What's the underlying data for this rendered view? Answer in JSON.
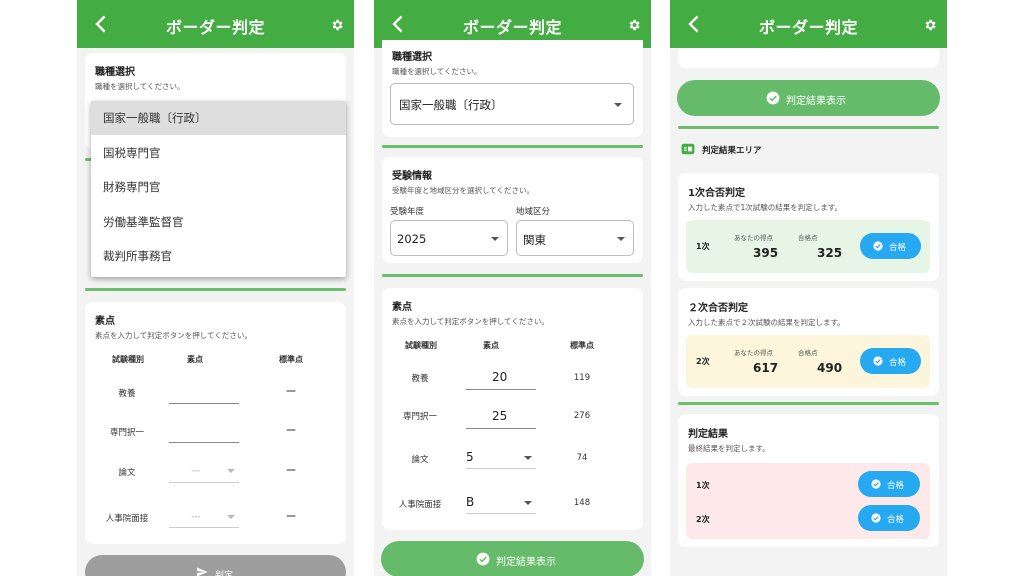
{
  "app": {
    "title": "ボーダー判定"
  },
  "job": {
    "title": "職種選択",
    "desc": "職種を選択してください。",
    "selected": "国家一般職〔行政〕",
    "options": [
      "国家一般職〔行政〕",
      "国税専門官",
      "財務専門官",
      "労働基準監督官",
      "裁判所事務官"
    ]
  },
  "exam": {
    "title": "受験情報",
    "desc": "受験年度と地域区分を選択してください。",
    "year_label": "受験年度",
    "year_value": "2025",
    "region_label": "地域区分",
    "region_value": "関東"
  },
  "score": {
    "title": "素点",
    "desc": "素点を入力して判定ボタンを押してください。",
    "headers": [
      "試験種別",
      "素点",
      "標準点"
    ],
    "empty_dash": "ー",
    "placeholder_select": "---",
    "rows": [
      {
        "label": "教養",
        "value": "20",
        "std": "119"
      },
      {
        "label": "専門択一",
        "value": "25",
        "std": "276"
      },
      {
        "label": "論文",
        "value": "5",
        "std": "74"
      },
      {
        "label": "人事院面接",
        "value": "B",
        "std": "148"
      }
    ],
    "judge_button": "判定"
  },
  "show_result_button": "判定結果表示",
  "result_area": {
    "title": "判定結果エリア",
    "first": {
      "title": "1次合否判定",
      "desc": "入力した素点で1次試験の結果を判定します。",
      "tag": "1次",
      "your_label": "あなたの得点",
      "pass_label": "合格点",
      "your_score": "395",
      "pass_score": "325",
      "result": "合格"
    },
    "second": {
      "title": "２次合否判定",
      "desc": "入力した素点で２次試験の結果を判定します。",
      "tag": "2次",
      "your_label": "あなたの得点",
      "pass_label": "合格点",
      "your_score": "617",
      "pass_score": "490",
      "result": "合格"
    },
    "final": {
      "title": "判定結果",
      "desc": "最終結果を判定します。",
      "row1": "1次",
      "row2": "2次",
      "result1": "合格",
      "result2": "合格"
    }
  },
  "colors": {
    "primary": "#43ad43",
    "accent": "#26a9f0",
    "first_bg": "#e6f5e6",
    "second_bg": "#fdf6dc",
    "final_bg": "#fde8ea"
  }
}
